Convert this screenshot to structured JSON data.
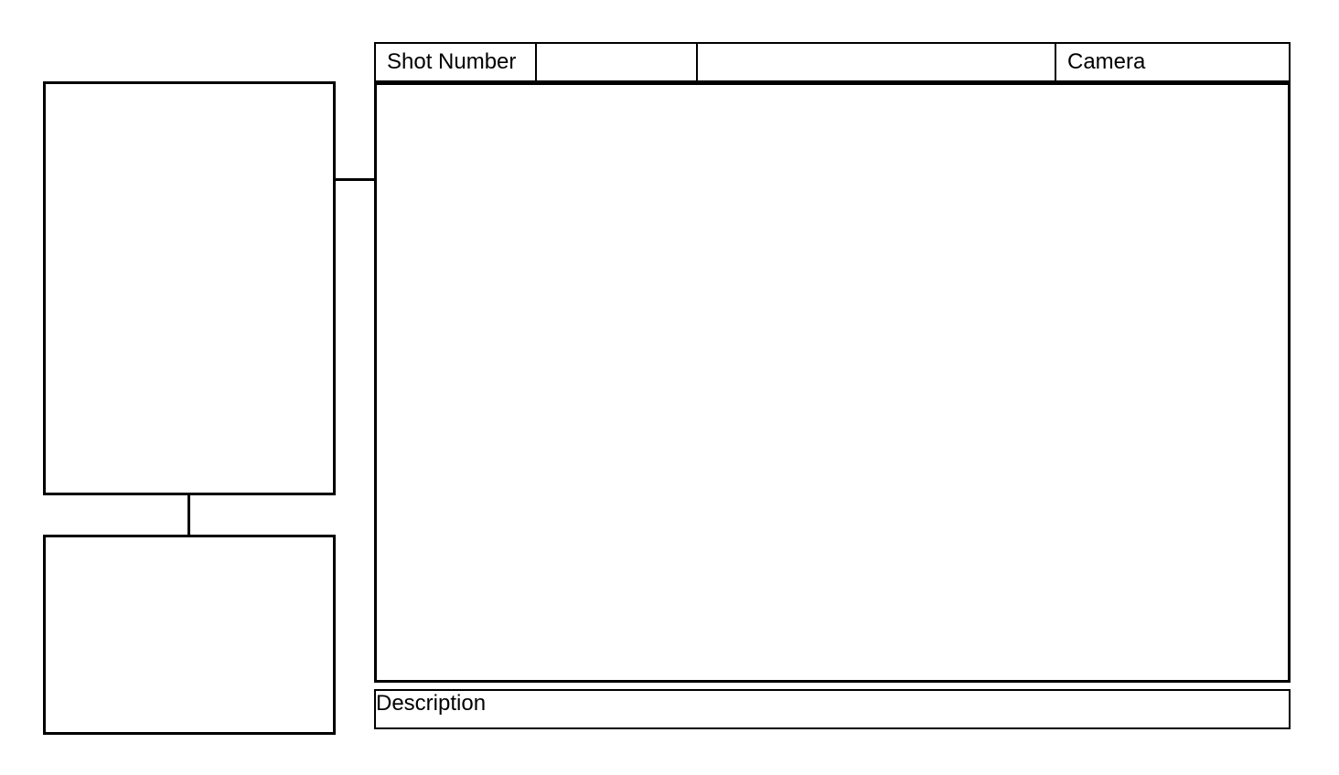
{
  "header": {
    "shot_number_label": "Shot Number",
    "shot_number_value": "",
    "camera_label": "Camera"
  },
  "footer": {
    "description_label": "Description",
    "description_value": ""
  }
}
